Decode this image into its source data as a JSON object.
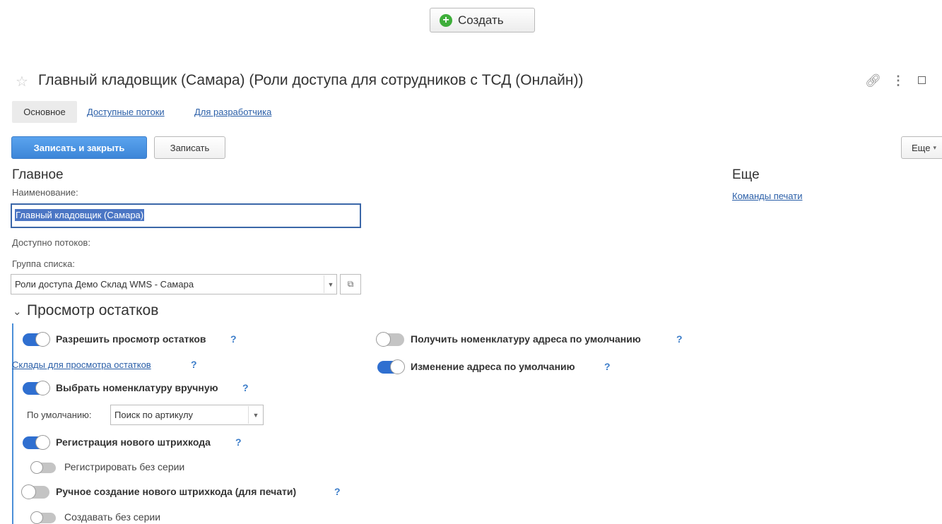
{
  "toolbar": {
    "create_label": "Создать"
  },
  "form": {
    "title": "Главный кладовщик (Самара) (Роли доступа для сотрудников с ТСД (Онлайн))",
    "tabs": [
      {
        "label": "Основное",
        "active": true
      },
      {
        "label": "Доступные потоки",
        "active": false
      },
      {
        "label": "Для разработчика",
        "active": false
      }
    ],
    "commands": {
      "save_close": "Записать и закрыть",
      "save": "Записать",
      "more": "Еще"
    }
  },
  "main": {
    "heading": "Главное",
    "name_label": "Наименование:",
    "name_value": "Главный кладовщик (Самара)",
    "threads_label": "Доступно потоков:",
    "group_label": "Группа списка:",
    "group_value": "Роли доступа Демо Склад WMS - Самара"
  },
  "side": {
    "heading": "Еще",
    "print_link": "Команды печати"
  },
  "stock_section": {
    "title": "Просмотр остатков",
    "help": "?",
    "options": {
      "allow_view": {
        "label": "Разрешить просмотр остатков",
        "on": true
      },
      "warehouses_link": "Склады для просмотра остатков",
      "manual_item": {
        "label": "Выбрать номенклатуру вручную",
        "on": true
      },
      "default_label": "По умолчанию:",
      "default_value": "Поиск по артикулу",
      "new_barcode": {
        "label": "Регистрация нового штрихкода",
        "on": true
      },
      "register_no_series": {
        "label": "Регистрировать без серии",
        "on": false
      },
      "manual_barcode": {
        "label": "Ручное создание нового штрихкода (для печати)",
        "on": false
      },
      "create_no_series": {
        "label": "Создавать без серии",
        "on": false
      },
      "default_address_item": {
        "label": "Получить номенклатуру адреса по умолчанию",
        "on": false
      },
      "change_default_address": {
        "label": "Изменение адреса по умолчанию",
        "on": true
      }
    }
  },
  "colors": {
    "accent": "#3d86d8",
    "link": "#2b5fa8",
    "toggle_on": "#2f6fd0",
    "create_icon": "#3eae3a"
  }
}
